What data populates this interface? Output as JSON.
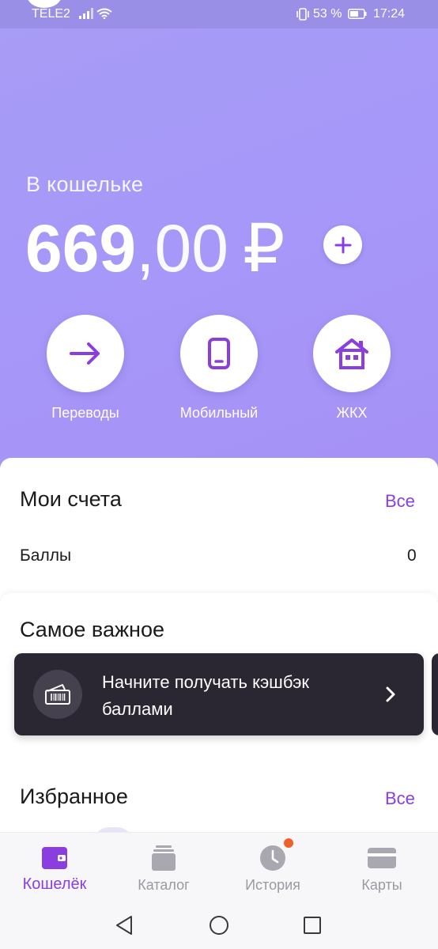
{
  "status_bar": {
    "carrier": "TELE2",
    "battery_percent": "53 %",
    "time": "17:24"
  },
  "wallet": {
    "label": "В кошельке",
    "balance_int": "669",
    "balance_frac": ",00",
    "currency": "₽"
  },
  "quick_actions": [
    {
      "label": "Переводы",
      "icon": "arrow-right-icon"
    },
    {
      "label": "Мобильный",
      "icon": "phone-icon"
    },
    {
      "label": "ЖКХ",
      "icon": "house-icon"
    }
  ],
  "accounts": {
    "title": "Мои счета",
    "link": "Все",
    "rows": [
      {
        "label": "Баллы",
        "value": "0"
      }
    ]
  },
  "important": {
    "title": "Самое важное",
    "promo_text": "Начните получать кэшбэк баллами"
  },
  "favorites": {
    "title": "Избранное",
    "link": "Все"
  },
  "bottom_nav": [
    {
      "label": "Кошелёк",
      "icon": "wallet-icon",
      "active": true
    },
    {
      "label": "Каталог",
      "icon": "catalog-icon",
      "active": false
    },
    {
      "label": "История",
      "icon": "clock-icon",
      "active": false
    },
    {
      "label": "Карты",
      "icon": "card-icon",
      "active": false
    }
  ],
  "colors": {
    "accent": "#8a3ee0",
    "hero": "#a69af7",
    "promo_bg": "#2a2733",
    "notification": "#f0602a"
  }
}
